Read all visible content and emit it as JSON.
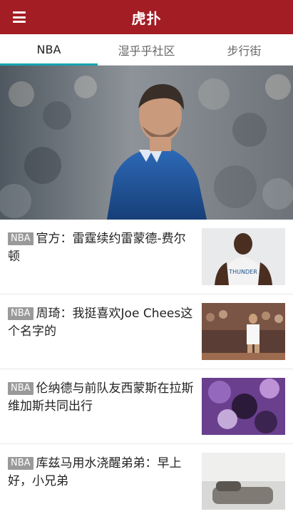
{
  "header": {
    "title": "虎扑",
    "background": "#a31d24"
  },
  "tabs": [
    {
      "label": "NBA",
      "active": true
    },
    {
      "label": "湿乎乎社区",
      "active": false
    },
    {
      "label": "步行街",
      "active": false
    }
  ],
  "accent_color": "#17a3b1",
  "news": [
    {
      "badge": "NBA",
      "title": "官方：雷霆续约雷蒙德-费尔顿"
    },
    {
      "badge": "NBA",
      "title": "周琦：我挺喜欢Joe Chees这个名字的"
    },
    {
      "badge": "NBA",
      "title": "伦纳德与前队友西蒙斯在拉斯维加斯共同出行"
    },
    {
      "badge": "NBA",
      "title": "库兹马用水浇醒弟弟：早上好，小兄弟"
    }
  ],
  "icons": {
    "menu": "menu-icon"
  }
}
